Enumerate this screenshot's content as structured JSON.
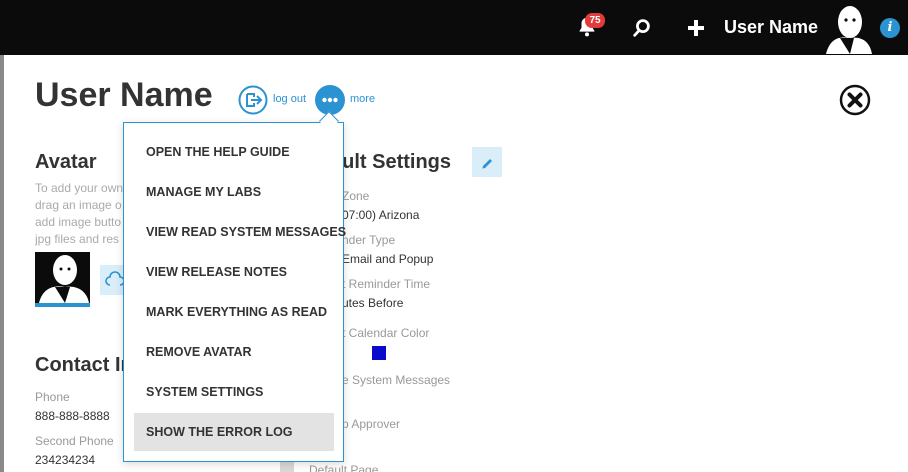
{
  "topbar": {
    "notification_count": "75",
    "user_name": "User Name",
    "icons": [
      "bell-icon",
      "search-icon",
      "plus-icon",
      "avatar",
      "info-icon"
    ],
    "info_glyph": "i",
    "colors": {
      "bar": "#0b0b0b",
      "badge": "#e23b3b",
      "accent": "#2b93d1"
    }
  },
  "header": {
    "title": "User Name",
    "logout_label": "log out",
    "more_label": "more"
  },
  "avatar_section": {
    "title": "Avatar",
    "desc_lines": [
      "To add your own",
      "drag an image o",
      "add image butto",
      "jpg files and res"
    ]
  },
  "contact_section": {
    "title": "Contact In",
    "phone_label": "Phone",
    "phone_value": "888-888-8888",
    "second_phone_label": "Second Phone",
    "second_phone_value": "234234234"
  },
  "settings_section": {
    "title": "ault Settings",
    "fields": [
      {
        "label": "Zone",
        "value": "07:00) Arizona"
      },
      {
        "label": "nder Type",
        "value": "Email and Popup"
      },
      {
        "label": "t Reminder Time",
        "value": "utes Before"
      },
      {
        "label": "t Calendar Color",
        "value": ""
      },
      {
        "label": "e System Messages",
        "value": ""
      },
      {
        "label": "p Approver",
        "value": ""
      },
      {
        "label": "Default Page",
        "value": ""
      }
    ],
    "calendar_color": "#0a0acc"
  },
  "more_menu": {
    "items": [
      "OPEN THE HELP GUIDE",
      "MANAGE MY LABS",
      "VIEW READ SYSTEM MESSAGES",
      "VIEW RELEASE NOTES",
      "MARK EVERYTHING AS READ",
      "REMOVE AVATAR",
      "SYSTEM SETTINGS",
      "SHOW THE ERROR LOG"
    ],
    "active_index": 7
  }
}
